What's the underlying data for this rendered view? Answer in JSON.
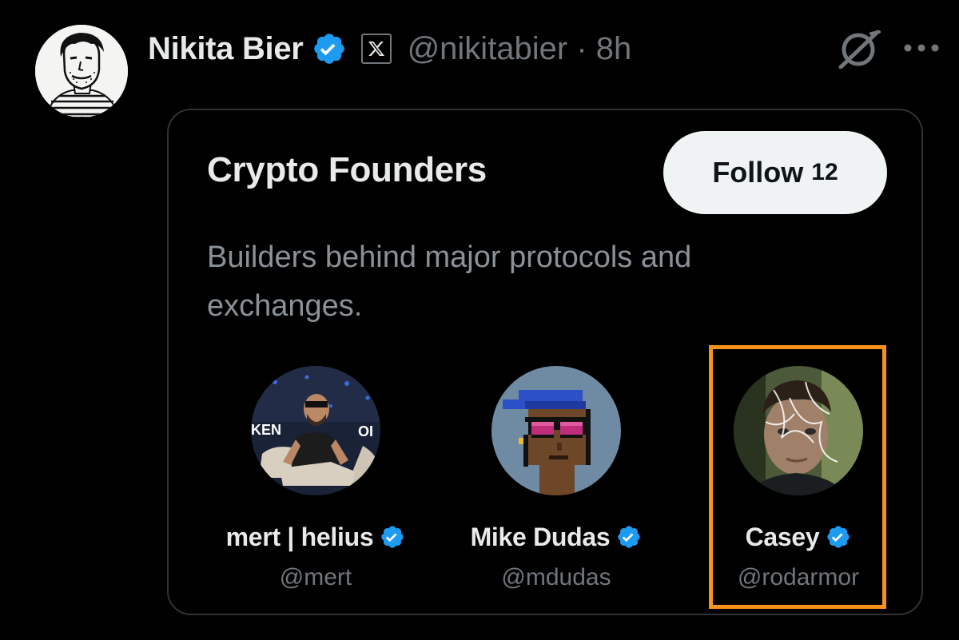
{
  "post": {
    "author_name": "Nikita Bier",
    "handle_meta": "@nikitabier · 8h"
  },
  "icons": {
    "verified": "verified-badge-icon",
    "affiliate": "x-logo-icon",
    "grok": "grok-icon",
    "more": "more-icon"
  },
  "list_card": {
    "title": "Crypto Founders",
    "description": "Builders behind major protocols and exchanges.",
    "follow_label": "Follow",
    "follow_count": "12",
    "members": [
      {
        "name": "mert | helius",
        "handle": "@mert"
      },
      {
        "name": "Mike Dudas",
        "handle": "@mdudas"
      },
      {
        "name": "Casey",
        "handle": "@rodarmor"
      }
    ]
  },
  "colors": {
    "background": "#000000",
    "verified_blue": "#1d9bf0",
    "highlight": "#f7931a",
    "card_border": "#2f3336"
  }
}
